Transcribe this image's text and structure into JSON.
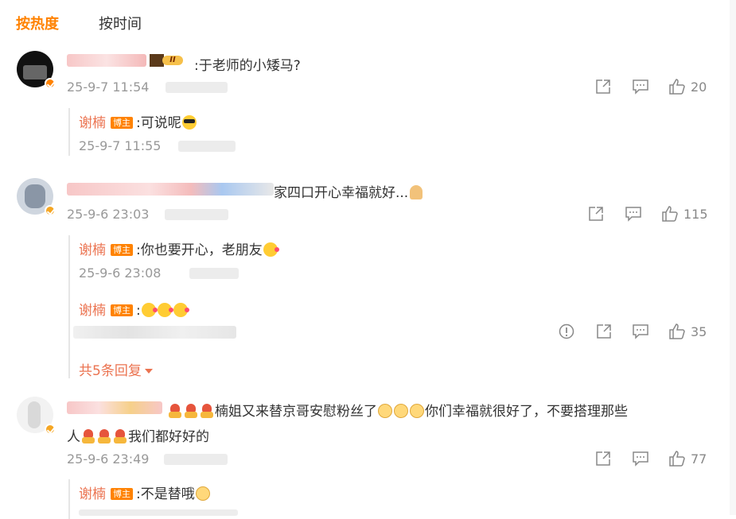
{
  "tabs": [
    {
      "label": "按热度"
    },
    {
      "label": "按时间"
    }
  ],
  "comments": [
    {
      "text": ":于老师的小矮马?",
      "level_badge": "II",
      "time": "25-9-7 11:54",
      "likes": "20",
      "replies": [
        {
          "author": "谢楠",
          "tag": "博主",
          "text": ":可说呢",
          "time": "25-9-7 11:55"
        }
      ]
    },
    {
      "text": "家四口开心幸福就好...",
      "time": "25-9-6 23:03",
      "likes": "115",
      "replies": [
        {
          "author": "谢楠",
          "tag": "博主",
          "text": ":你也要开心，老朋友",
          "time": "25-9-6 23:08"
        },
        {
          "author": "谢楠",
          "tag": "博主",
          "text": ":",
          "likes": "35"
        }
      ],
      "more_replies": "共5条回复"
    },
    {
      "text_line1": "楠姐又来替京哥安慰粉丝了",
      "text_line1b": "你们幸福就很好了，不要搭理那些",
      "text_line2a": "人",
      "text_line2b": "我们都好好的",
      "time": "25-9-6 23:49",
      "likes": "77",
      "replies": [
        {
          "author": "谢楠",
          "tag": "博主",
          "text": ":不是替哦"
        }
      ]
    }
  ],
  "colors": {
    "accent": "#ff8200",
    "reply_name": "#eb7350",
    "meta": "#999999"
  },
  "icons": {
    "share": "share-icon",
    "comment": "comment-icon",
    "like": "like-icon",
    "report": "report-icon"
  }
}
